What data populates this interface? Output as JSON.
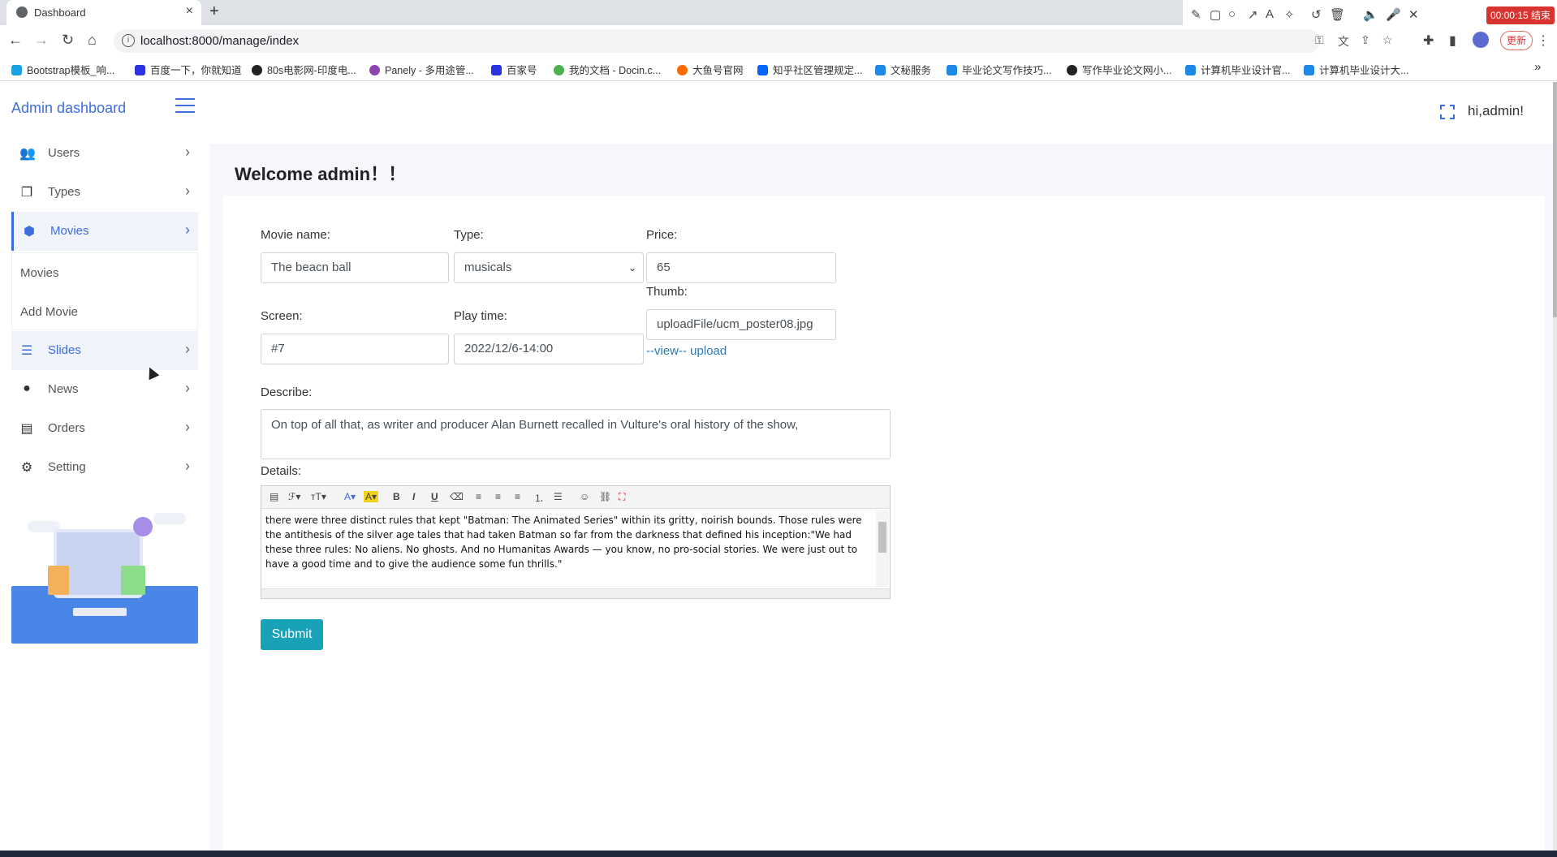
{
  "browser": {
    "tab_title": "Dashboard",
    "tab_close": "×",
    "new_tab": "+",
    "url": "localhost:8000/manage/index",
    "update_label": "更新",
    "recorder_timer": "00:00:15 结束",
    "bookmarks": [
      {
        "label": "Bootstrap模板_响...",
        "color": "#1ba1e2"
      },
      {
        "label": "百度一下，你就知道",
        "color": "#2932e1"
      },
      {
        "label": "80s电影网-印度电...",
        "color": "#222222"
      },
      {
        "label": "Panely - 多用途管...",
        "color": "#8e44ad"
      },
      {
        "label": "百家号",
        "color": "#2932e1"
      },
      {
        "label": "我的文档 - Docin.c...",
        "color": "#4caf50"
      },
      {
        "label": "大鱼号官网",
        "color": "#ff6a00"
      },
      {
        "label": "知乎社区管理规定...",
        "color": "#0066ff"
      },
      {
        "label": "文秘服务",
        "color": "#1e88e5"
      },
      {
        "label": "毕业论文写作技巧...",
        "color": "#1e88e5"
      },
      {
        "label": "写作毕业论文网小...",
        "color": "#222222"
      },
      {
        "label": "计算机毕业设计官...",
        "color": "#1e88e5"
      },
      {
        "label": "计算机毕业设计大...",
        "color": "#1e88e5"
      }
    ]
  },
  "sidebar": {
    "brand": "Admin dashboard",
    "items": [
      {
        "label": "Users",
        "icon": "users-icon"
      },
      {
        "label": "Types",
        "icon": "copy-icon"
      },
      {
        "label": "Movies",
        "icon": "box-icon"
      },
      {
        "label": "Slides",
        "icon": "list-icon"
      },
      {
        "label": "News",
        "icon": "circle-icon"
      },
      {
        "label": "Orders",
        "icon": "file-icon"
      },
      {
        "label": "Setting",
        "icon": "gear-icon"
      }
    ],
    "submenu": [
      "Movies",
      "Add Movie"
    ]
  },
  "header": {
    "greeting": "hi,admin!"
  },
  "main": {
    "title": "Welcome admin！！",
    "form": {
      "movie_name_label": "Movie name:",
      "movie_name_value": "The beacn ball",
      "type_label": "Type:",
      "type_value": "musicals",
      "price_label": "Price:",
      "price_value": "65",
      "screen_label": "Screen:",
      "screen_value": "#7",
      "play_time_label": "Play time:",
      "play_time_value": "2022/12/6-14:00",
      "thumb_label": "Thumb:",
      "thumb_value": "uploadFile/ucm_poster08.jpg",
      "view_link": "--view--",
      "upload_link": "upload",
      "describe_label": "Describe:",
      "describe_value": "On top of all that, as writer and producer Alan Burnett recalled in Vulture's oral history of the show,",
      "details_label": "Details:",
      "details_value": "there were three distinct rules that kept \"Batman: The Animated Series\" within its gritty, noirish bounds. Those rules were the antithesis of the silver age tales that had taken Batman so far from the darkness that defined his inception:\"We had these three rules: No aliens. No ghosts. And no Humanitas Awards — you know, no pro-social stories. We were just out to have a good time and to give the audience some fun thrills.\"",
      "submit_label": "Submit"
    }
  }
}
